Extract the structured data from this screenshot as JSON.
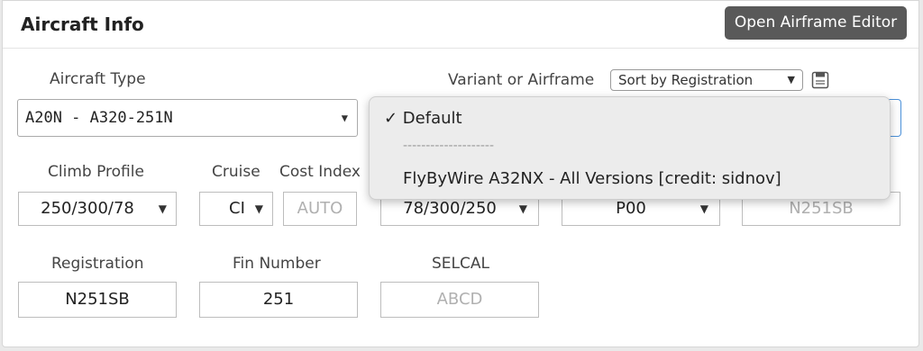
{
  "header": {
    "title": "Aircraft Info",
    "editor_button": "Open Airframe Editor"
  },
  "labels": {
    "aircraft_type": "Aircraft Type",
    "variant": "Variant or Airframe",
    "climb": "Climb Profile",
    "cruise": "Cruise",
    "cost_index": "Cost Index",
    "registration": "Registration",
    "fin": "Fin Number",
    "selcal": "SELCAL"
  },
  "fields": {
    "aircraft_type": "A20N - A320-251N",
    "sort_by": "Sort by Registration",
    "climb": "250/300/78",
    "cruise": "CI",
    "cost_index_placeholder": "AUTO",
    "descent": "78/300/250",
    "perf": "P00",
    "registration_placeholder": "N251SB",
    "registration": "N251SB",
    "fin": "251",
    "selcal_placeholder": "ABCD"
  },
  "dropdown": {
    "items": [
      "✓ Default",
      "FlyByWire A32NX - All Versions [credit: sidnov]"
    ],
    "separator": "--------------------"
  },
  "icons": {
    "save": "save-icon",
    "caret": "chevron-down-icon"
  }
}
